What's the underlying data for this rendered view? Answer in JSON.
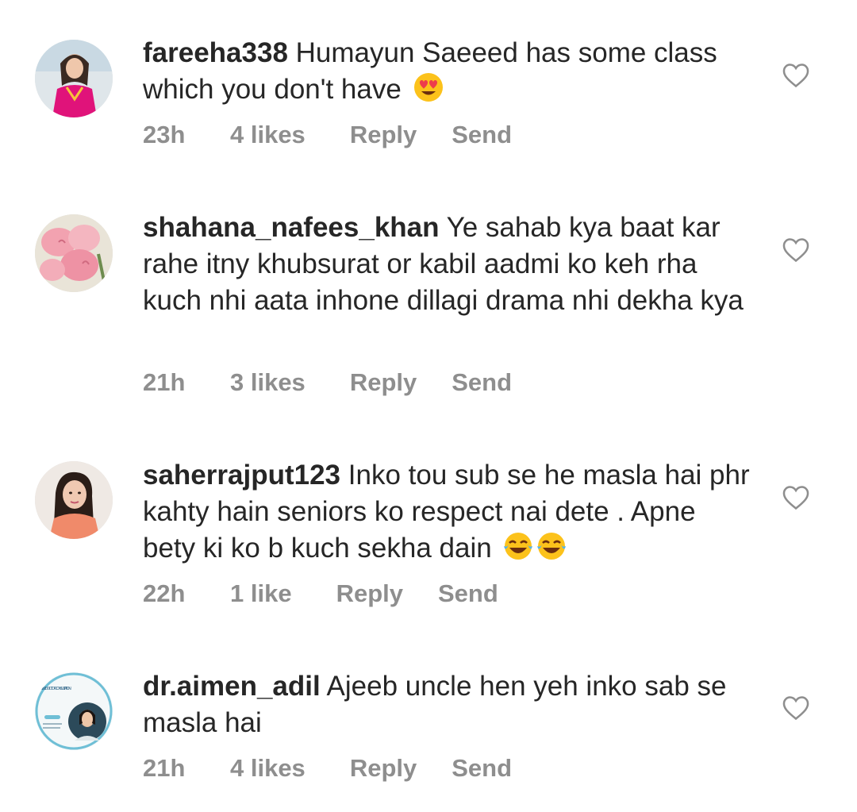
{
  "comments": [
    {
      "username": "fareeha338",
      "text": "Humayun Saeeed has some class which you don't have",
      "emoji": "heart-eyes-emoji",
      "time": "23h",
      "likes": "4 likes",
      "reply": "Reply",
      "send": "Send"
    },
    {
      "username": "shahana_nafees_khan",
      "text": "Ye sahab kya baat kar rahe itny khubsurat or kabil aadmi ko keh rha kuch nhi aata inhone dillagi drama nhi dekha kya",
      "time": "21h",
      "likes": "3 likes",
      "reply": "Reply",
      "send": "Send"
    },
    {
      "username": "saherrajput123",
      "text": "Inko tou sub se he masla hai phr kahty hain seniors ko respect nai dete . Apne bety ki ko b kuch sekha dain",
      "emoji": "tears-of-joy-emoji",
      "time": "22h",
      "likes": "1 like",
      "reply": "Reply",
      "send": "Send"
    },
    {
      "username": "dr.aimen_adil",
      "text": "Ajeeb uncle hen yeh inko sab se masla hai",
      "avatar_text": "NLINE DOCTOR CONSULTATION",
      "time": "21h",
      "likes": "4 likes",
      "reply": "Reply",
      "send": "Send"
    }
  ],
  "colors": {
    "text": "#262626",
    "meta": "#8e8e8e",
    "heart": "#8e8e8e"
  }
}
